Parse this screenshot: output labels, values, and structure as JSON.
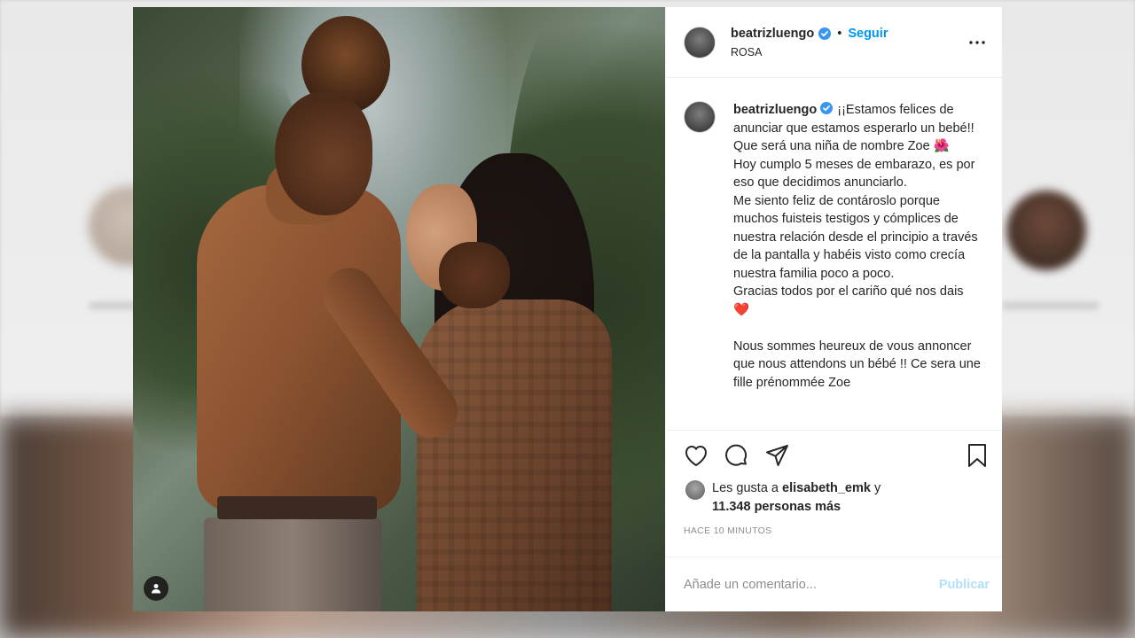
{
  "post": {
    "username": "beatrizluengo",
    "follow_label": "Seguir",
    "separator": "•",
    "location": "ROSA",
    "caption": "¡¡Estamos felices de anunciar que estamos esperarlo un bebé!! Que será una niña de nombre Zoe 🌺\nHoy cumplo 5 meses de embarazo, es por eso que decidimos anunciarlo.\nMe siento feliz de contároslo porque muchos fuisteis testigos y cómplices de nuestra relación desde el principio a través de la pantalla y habéis visto como crecía nuestra familia poco a poco.\nGracias todos por el cariño qué nos dais ❤️\n\nNous sommes heureux de vous annoncer que nous attendons un bébé !! Ce sera une fille prénommée Zoe",
    "likes_prefix": "Les gusta a",
    "likes_user": "elisabeth_emk",
    "likes_and": "y",
    "likes_count": "11.348 personas más",
    "time": "HACE 10 MINUTOS"
  },
  "comment": {
    "placeholder": "Añade un comentario...",
    "publish_label": "Publicar"
  },
  "icons": {
    "verified": "verified-badge-icon",
    "more": "more-options-icon",
    "like": "heart-icon",
    "comment": "comment-icon",
    "share": "share-icon",
    "save": "bookmark-icon",
    "tag": "user-tag-icon"
  },
  "colors": {
    "accent": "#0095f6",
    "verified": "#3897f0",
    "text": "#262626",
    "muted": "#8e8e8e",
    "publish_disabled": "#b2dffc"
  }
}
